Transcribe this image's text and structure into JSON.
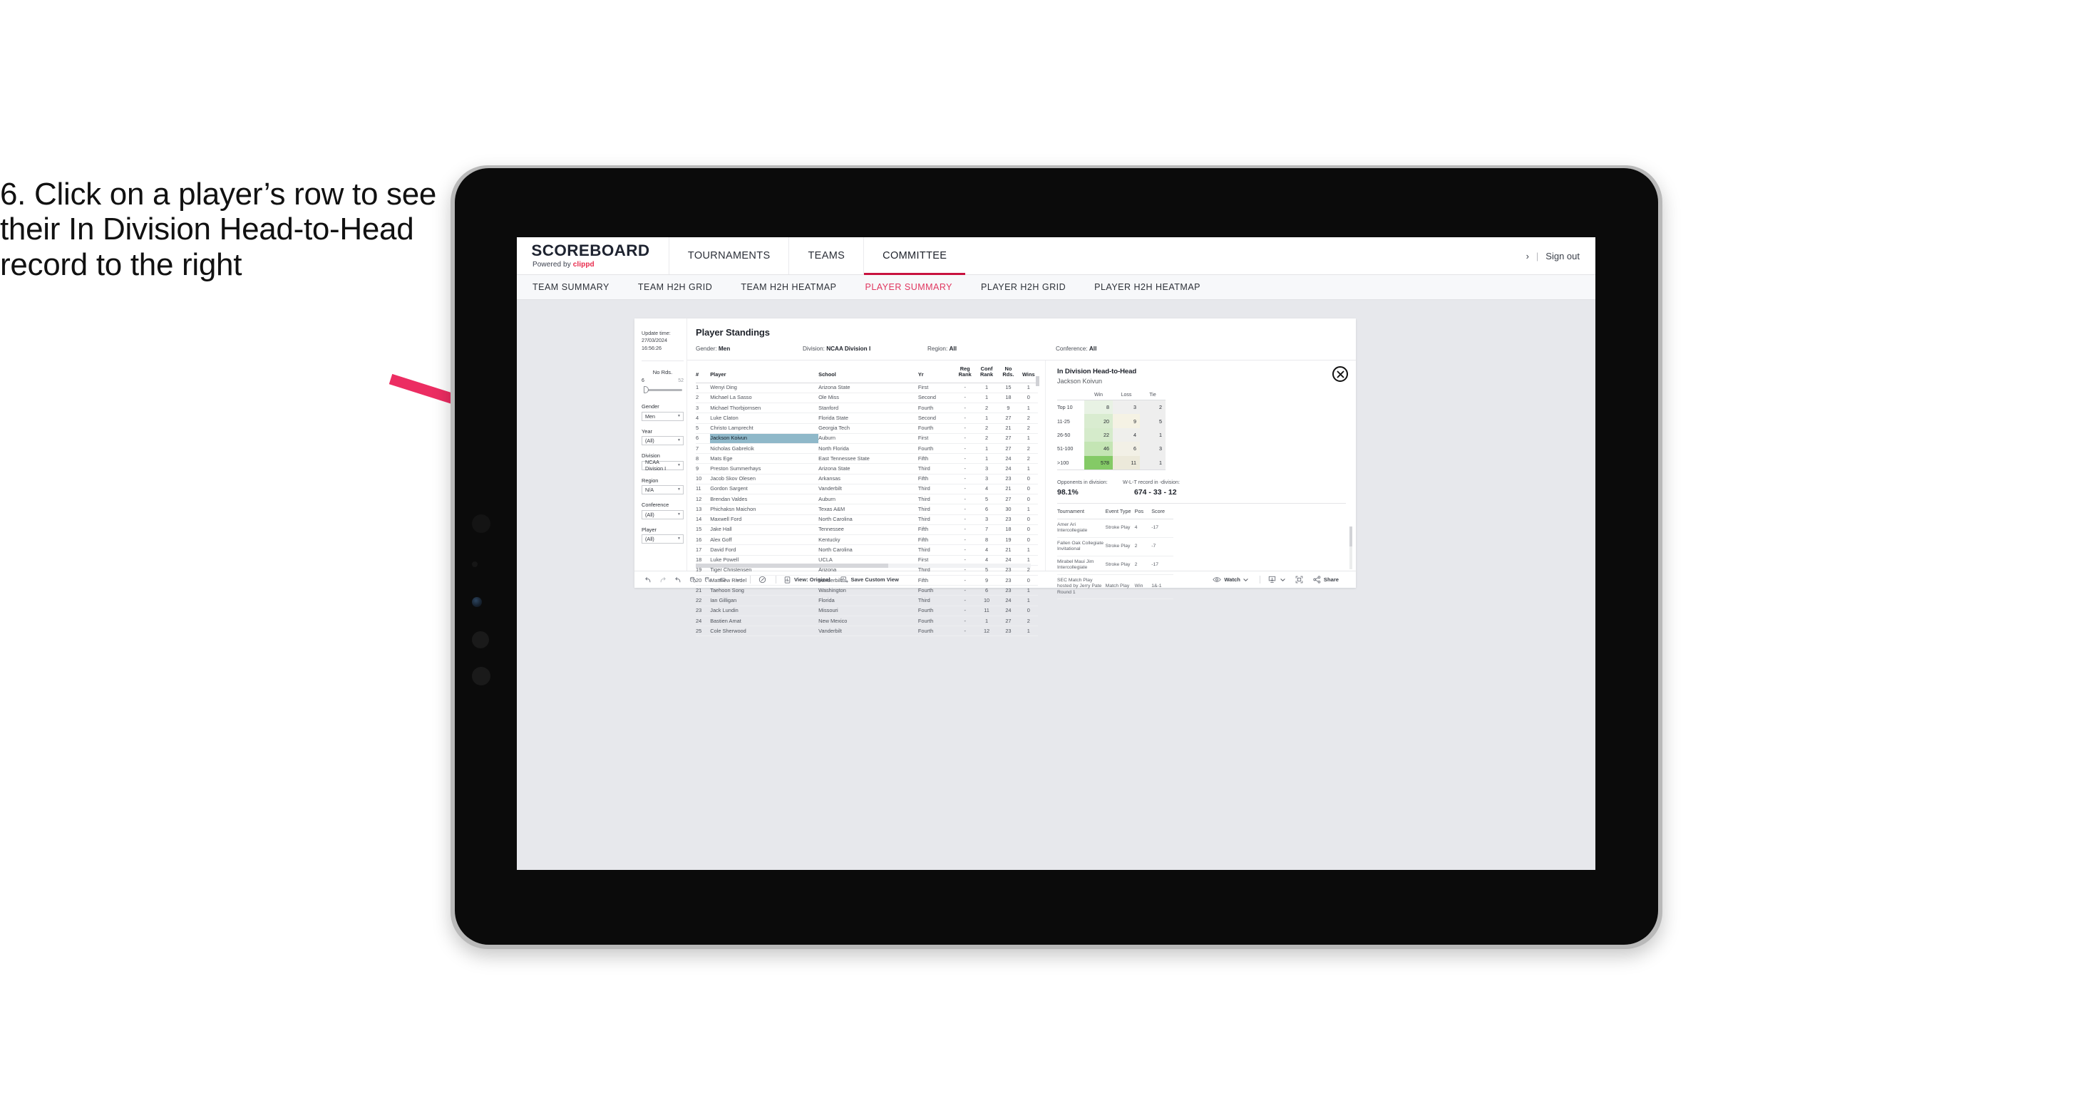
{
  "annotation": {
    "text": "6. Click on a player’s row to see their In Division Head-to-Head record to the right",
    "arrow_color": "#ec2d62"
  },
  "app": {
    "brand_title": "SCOREBOARD",
    "brand_sub_prefix": "Powered by ",
    "brand_sub_name": "clippd",
    "top_nav": [
      {
        "label": "TOURNAMENTS",
        "active": false
      },
      {
        "label": "TEAMS",
        "active": false
      },
      {
        "label": "COMMITTEE",
        "active": true
      }
    ],
    "account": {
      "chevron": "›",
      "separator": "|",
      "sign_out": "Sign out"
    },
    "sub_tabs": [
      {
        "label": "TEAM SUMMARY",
        "active": false
      },
      {
        "label": "TEAM H2H GRID",
        "active": false
      },
      {
        "label": "TEAM H2H HEATMAP",
        "active": false
      },
      {
        "label": "PLAYER SUMMARY",
        "active": true
      },
      {
        "label": "PLAYER H2H GRID",
        "active": false
      },
      {
        "label": "PLAYER H2H HEATMAP",
        "active": false
      }
    ],
    "accent_color": "#e0365f",
    "tab_underline_color": "#c8123f"
  },
  "filters": {
    "update_time_label": "Update time:",
    "update_time_value": "27/03/2024 16:56:26",
    "slider": {
      "label": "No Rds.",
      "min": "6",
      "max": "52",
      "value": 6
    },
    "groups": [
      {
        "label": "Gender",
        "value": "Men"
      },
      {
        "label": "Year",
        "value": "(All)"
      },
      {
        "label": "Division",
        "value": "NCAA Division I"
      },
      {
        "label": "Region",
        "value": "N/A"
      },
      {
        "label": "Conference",
        "value": "(All)"
      },
      {
        "label": "Player",
        "value": "(All)"
      }
    ]
  },
  "standings": {
    "title": "Player Standings",
    "chips": [
      {
        "label": "Gender: ",
        "value": "Men"
      },
      {
        "label": "Division: ",
        "value": "NCAA Division I"
      },
      {
        "label": "Region: ",
        "value": "All"
      },
      {
        "label": "Conference: ",
        "value": "All"
      }
    ],
    "columns": [
      "#",
      "Player",
      "School",
      "Yr",
      "Reg Rank",
      "Conf Rank",
      "No Rds.",
      "Wins"
    ],
    "column_lines": [
      [
        "#"
      ],
      [
        "Player"
      ],
      [
        "School"
      ],
      [
        "Yr"
      ],
      [
        "Reg",
        "Rank"
      ],
      [
        "Conf",
        "Rank"
      ],
      [
        "No",
        "Rds."
      ],
      [
        "Wins"
      ]
    ],
    "selected_row_index": 5,
    "selected_color": "#8fb8c9",
    "rows": [
      {
        "num": "1",
        "player": "Wenyi Ding",
        "school": "Arizona State",
        "yr": "First",
        "reg": "-",
        "conf": "1",
        "rds": "15",
        "wins": "1"
      },
      {
        "num": "2",
        "player": "Michael La Sasso",
        "school": "Ole Miss",
        "yr": "Second",
        "reg": "-",
        "conf": "1",
        "rds": "18",
        "wins": "0"
      },
      {
        "num": "3",
        "player": "Michael Thorbjornsen",
        "school": "Stanford",
        "yr": "Fourth",
        "reg": "-",
        "conf": "2",
        "rds": "9",
        "wins": "1"
      },
      {
        "num": "4",
        "player": "Luke Claton",
        "school": "Florida State",
        "yr": "Second",
        "reg": "-",
        "conf": "1",
        "rds": "27",
        "wins": "2"
      },
      {
        "num": "5",
        "player": "Christo Lamprecht",
        "school": "Georgia Tech",
        "yr": "Fourth",
        "reg": "-",
        "conf": "2",
        "rds": "21",
        "wins": "2"
      },
      {
        "num": "6",
        "player": "Jackson Koivun",
        "school": "Auburn",
        "yr": "First",
        "reg": "-",
        "conf": "2",
        "rds": "27",
        "wins": "1"
      },
      {
        "num": "7",
        "player": "Nicholas Gabrelcik",
        "school": "North Florida",
        "yr": "Fourth",
        "reg": "-",
        "conf": "1",
        "rds": "27",
        "wins": "2"
      },
      {
        "num": "8",
        "player": "Mats Ege",
        "school": "East Tennessee State",
        "yr": "Fifth",
        "reg": "-",
        "conf": "1",
        "rds": "24",
        "wins": "2"
      },
      {
        "num": "9",
        "player": "Preston Summerhays",
        "school": "Arizona State",
        "yr": "Third",
        "reg": "-",
        "conf": "3",
        "rds": "24",
        "wins": "1"
      },
      {
        "num": "10",
        "player": "Jacob Skov Olesen",
        "school": "Arkansas",
        "yr": "Fifth",
        "reg": "-",
        "conf": "3",
        "rds": "23",
        "wins": "0"
      },
      {
        "num": "11",
        "player": "Gordon Sargent",
        "school": "Vanderbilt",
        "yr": "Third",
        "reg": "-",
        "conf": "4",
        "rds": "21",
        "wins": "0"
      },
      {
        "num": "12",
        "player": "Brendan Valdes",
        "school": "Auburn",
        "yr": "Third",
        "reg": "-",
        "conf": "5",
        "rds": "27",
        "wins": "0"
      },
      {
        "num": "13",
        "player": "Phichaksn Maichon",
        "school": "Texas A&M",
        "yr": "Third",
        "reg": "-",
        "conf": "6",
        "rds": "30",
        "wins": "1"
      },
      {
        "num": "14",
        "player": "Maxwell Ford",
        "school": "North Carolina",
        "yr": "Third",
        "reg": "-",
        "conf": "3",
        "rds": "23",
        "wins": "0"
      },
      {
        "num": "15",
        "player": "Jake Hall",
        "school": "Tennessee",
        "yr": "Fifth",
        "reg": "-",
        "conf": "7",
        "rds": "18",
        "wins": "0"
      },
      {
        "num": "16",
        "player": "Alex Goff",
        "school": "Kentucky",
        "yr": "Fifth",
        "reg": "-",
        "conf": "8",
        "rds": "19",
        "wins": "0"
      },
      {
        "num": "17",
        "player": "David Ford",
        "school": "North Carolina",
        "yr": "Third",
        "reg": "-",
        "conf": "4",
        "rds": "21",
        "wins": "1"
      },
      {
        "num": "18",
        "player": "Luke Powell",
        "school": "UCLA",
        "yr": "First",
        "reg": "-",
        "conf": "4",
        "rds": "24",
        "wins": "1"
      },
      {
        "num": "19",
        "player": "Tiger Christensen",
        "school": "Arizona",
        "yr": "Third",
        "reg": "-",
        "conf": "5",
        "rds": "23",
        "wins": "2"
      },
      {
        "num": "20",
        "player": "Matthew Riedel",
        "school": "Vanderbilt",
        "yr": "Fifth",
        "reg": "-",
        "conf": "9",
        "rds": "23",
        "wins": "0"
      },
      {
        "num": "21",
        "player": "Taehoon Song",
        "school": "Washington",
        "yr": "Fourth",
        "reg": "-",
        "conf": "6",
        "rds": "23",
        "wins": "1"
      },
      {
        "num": "22",
        "player": "Ian Gilligan",
        "school": "Florida",
        "yr": "Third",
        "reg": "-",
        "conf": "10",
        "rds": "24",
        "wins": "1"
      },
      {
        "num": "23",
        "player": "Jack Lundin",
        "school": "Missouri",
        "yr": "Fourth",
        "reg": "-",
        "conf": "11",
        "rds": "24",
        "wins": "0"
      },
      {
        "num": "24",
        "player": "Bastien Amat",
        "school": "New Mexico",
        "yr": "Fourth",
        "reg": "-",
        "conf": "1",
        "rds": "27",
        "wins": "2"
      },
      {
        "num": "25",
        "player": "Cole Sherwood",
        "school": "Vanderbilt",
        "yr": "Fourth",
        "reg": "-",
        "conf": "12",
        "rds": "23",
        "wins": "1"
      }
    ]
  },
  "h2h": {
    "title": "In Division Head-to-Head",
    "player": "Jackson Koivun",
    "close_icon": "close-icon",
    "stats": [
      {
        "label": "Opponents in division:",
        "value": "98.1%"
      },
      {
        "label": "W-L-T record in -division:",
        "value": "674 - 33 - 12"
      }
    ],
    "tournaments_columns": [
      "Tournament",
      "Event Type",
      "Pos",
      "Score"
    ],
    "tournaments": [
      {
        "name": "Amer Ari Intercollegiate",
        "type": "Stroke Play",
        "pos": "4",
        "score": "-17"
      },
      {
        "name": "Fallen Oak Collegiate Invitational",
        "type": "Stroke Play",
        "pos": "2",
        "score": "-7"
      },
      {
        "name": "Mirabel Maui Jim Intercollegiate",
        "type": "Stroke Play",
        "pos": "2",
        "score": "-17"
      },
      {
        "name": "SEC Match Play hosted by Jerry Pate Round 1",
        "type": "Match Play",
        "pos": "Win",
        "score": "1&-1"
      }
    ]
  },
  "chart_data": {
    "type": "heatmap",
    "title": "In Division Head-to-Head",
    "subtitle": "Jackson Koivun",
    "row_header": "",
    "columns": [
      "Win",
      "Loss",
      "Tie"
    ],
    "rows": [
      "Top 10",
      "11-25",
      "26-50",
      "51-100",
      ">100"
    ],
    "values": [
      [
        8,
        3,
        2
      ],
      [
        20,
        9,
        5
      ],
      [
        22,
        4,
        1
      ],
      [
        46,
        6,
        3
      ],
      [
        578,
        11,
        1
      ]
    ],
    "cell_colors": [
      [
        "#e8f2e4",
        "#efefee",
        "#eeeeee"
      ],
      [
        "#d9ecd0",
        "#f5f2e4",
        "#eeeeee"
      ],
      [
        "#d5ebcb",
        "#efefec",
        "#eeeeee"
      ],
      [
        "#c4e5b4",
        "#f2f0e6",
        "#eeeeee"
      ],
      [
        "#84ca66",
        "#ece9da",
        "#eeeeee"
      ]
    ],
    "legend_position": "none",
    "grid": false
  },
  "toolbar": {
    "icons": [
      "undo-icon",
      "redo-icon",
      "revert-icon",
      "refresh-icon",
      "pause-icon",
      "shape-icon",
      "chevron-down-icon"
    ],
    "alerts_icon": "alerts-icon",
    "view_label": "View: Original",
    "view_icon": "view-icon",
    "save_label": "Save Custom View",
    "save_icon": "save-view-icon",
    "watch_label": "Watch",
    "watch_icon": "eye-icon",
    "download_icon": "download-icon",
    "fullscreen_icon": "fullscreen-icon",
    "share_label": "Share",
    "share_icon": "share-icon"
  }
}
